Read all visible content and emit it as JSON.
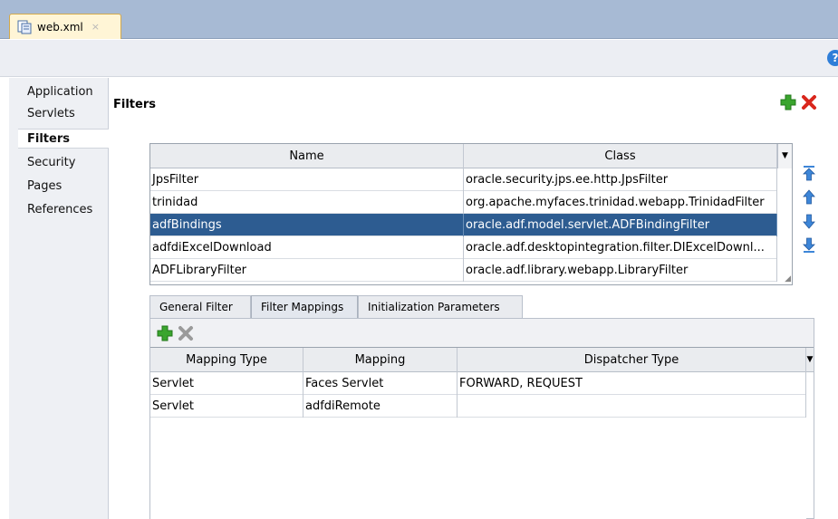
{
  "editor_tab": {
    "file_icon": "xml-file-icon",
    "label": "web.xml",
    "close_glyph": "×"
  },
  "toolbar": {
    "help_label": "?"
  },
  "sidebar": {
    "items": [
      {
        "label": "Application"
      },
      {
        "label": "Servlets"
      },
      {
        "label": "Filters"
      },
      {
        "label": "Security"
      },
      {
        "label": "Pages"
      },
      {
        "label": "References"
      }
    ],
    "selected": "Filters"
  },
  "filters": {
    "title": "Filters",
    "columns": [
      "Name",
      "Class"
    ],
    "rows": [
      {
        "name": "JpsFilter",
        "class": "oracle.security.jps.ee.http.JpsFilter"
      },
      {
        "name": "trinidad",
        "class": "org.apache.myfaces.trinidad.webapp.TrinidadFilter"
      },
      {
        "name": "adfBindings",
        "class": "oracle.adf.model.servlet.ADFBindingFilter"
      },
      {
        "name": "adfdiExcelDownload",
        "class": "oracle.adf.desktopintegration.filter.DIExcelDownl..."
      },
      {
        "name": "ADFLibraryFilter",
        "class": "oracle.adf.library.webapp.LibraryFilter"
      }
    ],
    "selected_row": "adfBindings",
    "drop_glyph": "▼"
  },
  "detail_tabs": {
    "tabs": [
      {
        "label": "General Filter"
      },
      {
        "label": "Filter Mappings"
      },
      {
        "label": "Initialization Parameters"
      }
    ],
    "active": "Filter Mappings"
  },
  "mappings": {
    "columns": [
      "Mapping Type",
      "Mapping",
      "Dispatcher Type"
    ],
    "rows": [
      {
        "type": "Servlet",
        "mapping": "Faces Servlet",
        "dispatcher": "FORWARD, REQUEST"
      },
      {
        "type": "Servlet",
        "mapping": "adfdiRemote",
        "dispatcher": ""
      }
    ],
    "drop_glyph": "▼"
  },
  "colors": {
    "selection": "#2d5c91",
    "add_green": "#3aa52e",
    "delete_red": "#d9261c",
    "arrow_blue": "#3d86d8"
  }
}
